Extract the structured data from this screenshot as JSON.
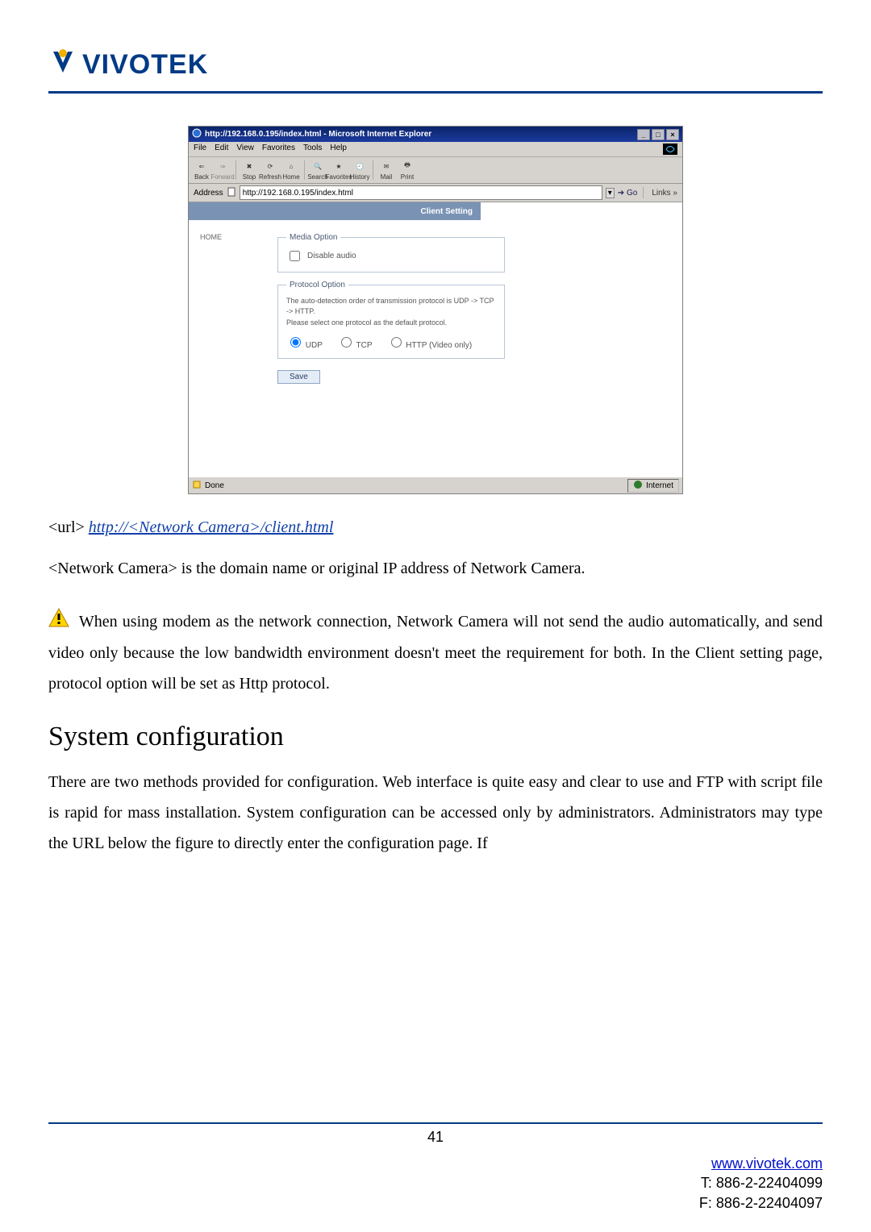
{
  "logo": {
    "text": "VIVOTEK"
  },
  "browser": {
    "title": "http://192.168.0.195/index.html - Microsoft Internet Explorer",
    "menu": [
      "File",
      "Edit",
      "View",
      "Favorites",
      "Tools",
      "Help"
    ],
    "toolbar": {
      "back": "Back",
      "forward": "Forward",
      "stop": "Stop",
      "refresh": "Refresh",
      "home": "Home",
      "search": "Search",
      "favorites": "Favorites",
      "history": "History",
      "mail": "Mail",
      "print": "Print"
    },
    "address_label": "Address",
    "address_value": "http://192.168.0.195/index.html",
    "go_label": "Go",
    "links_label": "Links »",
    "status_done": "Done",
    "status_zone": "Internet"
  },
  "clientpage": {
    "header": "Client Setting",
    "nav_home": "HOME",
    "media_legend": "Media Option",
    "disable_audio": "Disable audio",
    "protocol_legend": "Protocol Option",
    "protocol_msg1": "The auto-detection order of transmission protocol is UDP -> TCP -> HTTP.",
    "protocol_msg2": "Please select one protocol as the default protocol.",
    "udp": "UDP",
    "tcp": "TCP",
    "http": "HTTP (Video only)",
    "save": "Save"
  },
  "text": {
    "url_label": "<url> ",
    "url_link": "http://<Network Camera>/client.html",
    "url_note": "<Network Camera> is the domain name or original IP address of Network Camera.",
    "warning": "When using modem as the network connection, Network Camera will not send the audio automatically, and send video only because the low bandwidth environment doesn't meet the requirement for both. In the Client setting page, protocol option will be set as Http protocol.",
    "heading": "System configuration",
    "para": "There are two methods provided for configuration. Web interface is quite easy and clear to use and FTP with script file is rapid for mass installation. System configuration can be accessed only by administrators. Administrators may type the URL below the figure to directly enter the configuration page. If"
  },
  "footer": {
    "page": "41",
    "link": "www.vivotek.com",
    "tel": "T: 886-2-22404099",
    "fax": "F: 886-2-22404097"
  }
}
